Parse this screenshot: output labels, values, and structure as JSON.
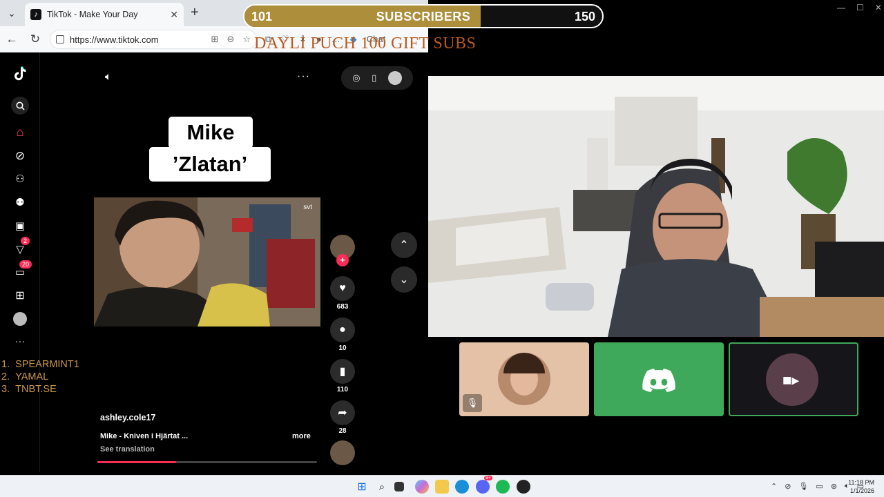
{
  "browser": {
    "tab_title": "TikTok - Make Your Day",
    "tab_close": "✕",
    "new_tab": "+",
    "url": "https://www.tiktok.com",
    "toolbar_partial_text": "Chat"
  },
  "overlay": {
    "subs_current": "101",
    "subs_label": "SUBSCRIBERS",
    "subs_goal": "150",
    "subs_progress_fraction": 0.66,
    "goal_text": "DAYLI  PUCH 100 GIFT SUBS"
  },
  "tiktok": {
    "sidebar_badges": {
      "messages": "2",
      "inbox": "20"
    },
    "leaderboard": [
      {
        "rank": "1.",
        "name": "SPEARMINT1"
      },
      {
        "rank": "2.",
        "name": "YAMAL"
      },
      {
        "rank": "3.",
        "name": "TNBT.SE"
      }
    ],
    "video_title_line1": "Mike",
    "video_title_line2": "’Zlatan’",
    "video_watermark": "svt",
    "actions": {
      "likes": "683",
      "comments": "10",
      "saves": "110",
      "shares": "28"
    },
    "username": "ashley.cole17",
    "song": "Mike - Kniven i Hjärtat ...",
    "more_label": "more",
    "translation_label": "See translation",
    "progress_fraction": 0.36
  },
  "taskbar": {
    "time": "11:18 PM",
    "date": "1/1/2026",
    "notification_badge": "9+"
  },
  "colors": {
    "tiktok_red": "#fe2c55",
    "subs_fill": "#ad8e3b",
    "goal_text": "#b85a1f",
    "leaderboard": "#c8964a",
    "discord_green": "#3fa95b"
  }
}
